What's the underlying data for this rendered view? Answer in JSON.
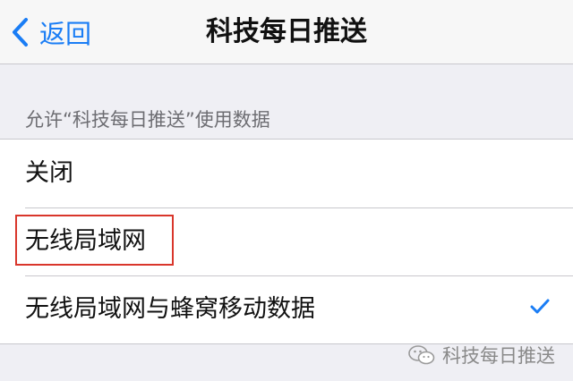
{
  "navbar": {
    "back_label": "返回",
    "title": "科技每日推送"
  },
  "section": {
    "header": "允许“科技每日推送”使用数据"
  },
  "options": [
    {
      "label": "关闭",
      "selected": false
    },
    {
      "label": "无线局域网",
      "selected": false,
      "highlighted": true
    },
    {
      "label": "无线局域网与蜂窝移动数据",
      "selected": true
    }
  ],
  "watermark": {
    "text": "科技每日推送",
    "icon": "wechat-icon"
  },
  "colors": {
    "accent": "#1a7df5",
    "highlight": "#d9362b",
    "background": "#efeff4"
  }
}
